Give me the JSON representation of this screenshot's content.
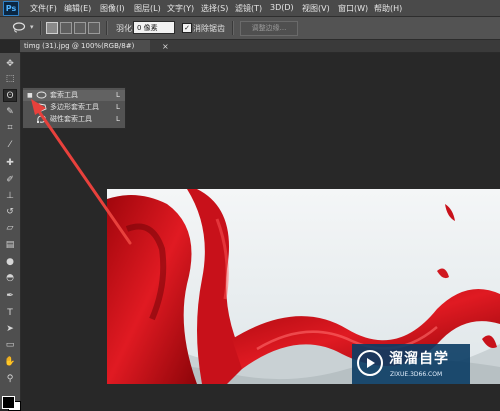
{
  "app": {
    "logo_text": "Ps"
  },
  "menu": {
    "items": [
      {
        "label": "文件(F)"
      },
      {
        "label": "编辑(E)"
      },
      {
        "label": "图像(I)"
      },
      {
        "label": "图层(L)"
      },
      {
        "label": "文字(Y)"
      },
      {
        "label": "选择(S)"
      },
      {
        "label": "滤镜(T)"
      },
      {
        "label": "3D(D)"
      },
      {
        "label": "视图(V)"
      },
      {
        "label": "窗口(W)"
      },
      {
        "label": "帮助(H)"
      }
    ]
  },
  "options": {
    "feather_label": "羽化:",
    "feather_value": "0 像素",
    "antialias_check": "✓",
    "antialias_label": "消除锯齿",
    "refine_edge_label": "调整边缘..."
  },
  "document": {
    "tab_title": "timg (31).jpg @ 100%(RGB/8#)",
    "close_glyph": "×"
  },
  "flyout": {
    "items": [
      {
        "label": "套索工具",
        "key": "L",
        "selected": true,
        "bullet": "■"
      },
      {
        "label": "多边形套索工具",
        "key": "L",
        "selected": false,
        "bullet": ""
      },
      {
        "label": "磁性套索工具",
        "key": "L",
        "selected": false,
        "bullet": ""
      }
    ]
  },
  "toolbox": {
    "tools": [
      {
        "name": "move-tool-icon",
        "glyph": "✥"
      },
      {
        "name": "marquee-tool-icon",
        "glyph": "⬚"
      },
      {
        "name": "lasso-tool-icon",
        "glyph": "ʘ",
        "active": true
      },
      {
        "name": "quick-select-tool-icon",
        "glyph": "✎"
      },
      {
        "name": "crop-tool-icon",
        "glyph": "⌗"
      },
      {
        "name": "eyedropper-tool-icon",
        "glyph": "⁄"
      },
      {
        "name": "healing-brush-tool-icon",
        "glyph": "✚"
      },
      {
        "name": "brush-tool-icon",
        "glyph": "✐"
      },
      {
        "name": "clone-stamp-tool-icon",
        "glyph": "⊥"
      },
      {
        "name": "history-brush-tool-icon",
        "glyph": "↺"
      },
      {
        "name": "eraser-tool-icon",
        "glyph": "▱"
      },
      {
        "name": "gradient-tool-icon",
        "glyph": "▤"
      },
      {
        "name": "blur-tool-icon",
        "glyph": "●"
      },
      {
        "name": "dodge-tool-icon",
        "glyph": "◓"
      },
      {
        "name": "pen-tool-icon",
        "glyph": "✒"
      },
      {
        "name": "type-tool-icon",
        "glyph": "T"
      },
      {
        "name": "path-select-tool-icon",
        "glyph": "➤"
      },
      {
        "name": "shape-tool-icon",
        "glyph": "▭"
      },
      {
        "name": "hand-tool-icon",
        "glyph": "✋"
      },
      {
        "name": "zoom-tool-icon",
        "glyph": "⚲"
      }
    ]
  },
  "watermark": {
    "title": "溜溜自学",
    "subtitle": "ZIXUE.3D66.COM"
  },
  "colors": {
    "annotation_arrow": "#e8413c",
    "silk_red": "#d8121a",
    "watermark_bg": "#0a3c64"
  }
}
